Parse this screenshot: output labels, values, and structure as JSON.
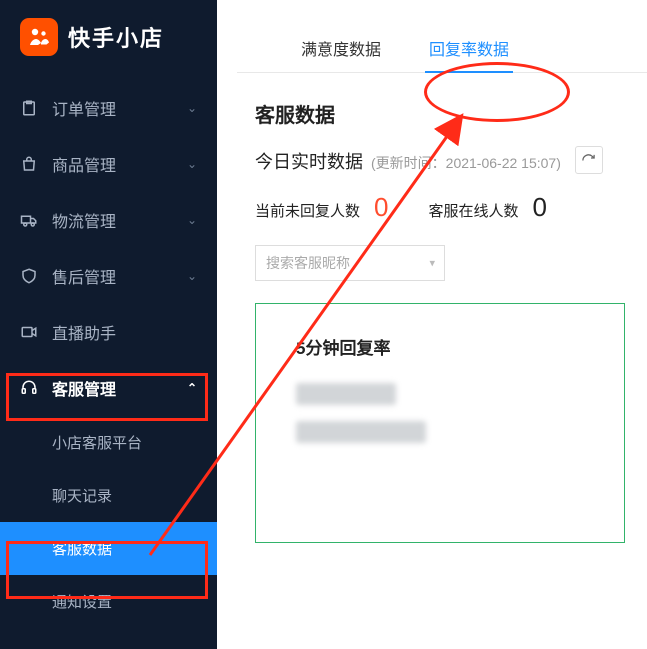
{
  "brand": {
    "name": "快手小店"
  },
  "sidebar": {
    "items": [
      {
        "label": "订单管理",
        "icon": "clipboard-icon"
      },
      {
        "label": "商品管理",
        "icon": "bag-icon"
      },
      {
        "label": "物流管理",
        "icon": "truck-icon"
      },
      {
        "label": "售后管理",
        "icon": "shield-icon"
      },
      {
        "label": "直播助手",
        "icon": "video-icon"
      },
      {
        "label": "客服管理",
        "icon": "headset-icon"
      }
    ],
    "sub": [
      {
        "label": "小店客服平台"
      },
      {
        "label": "聊天记录"
      },
      {
        "label": "客服数据"
      },
      {
        "label": "通知设置"
      }
    ]
  },
  "tabs": [
    {
      "label": "满意度数据"
    },
    {
      "label": "回复率数据"
    }
  ],
  "section": {
    "title": "客服数据"
  },
  "realtime": {
    "title": "今日实时数据",
    "meta": "(更新时间：2021-06-22 15:07)"
  },
  "metrics": {
    "unreplied": {
      "label": "当前未回复人数",
      "value": "0"
    },
    "online": {
      "label": "客服在线人数",
      "value": "0"
    }
  },
  "search": {
    "placeholder": "搜索客服昵称"
  },
  "card": {
    "title": "5分钟回复率"
  }
}
